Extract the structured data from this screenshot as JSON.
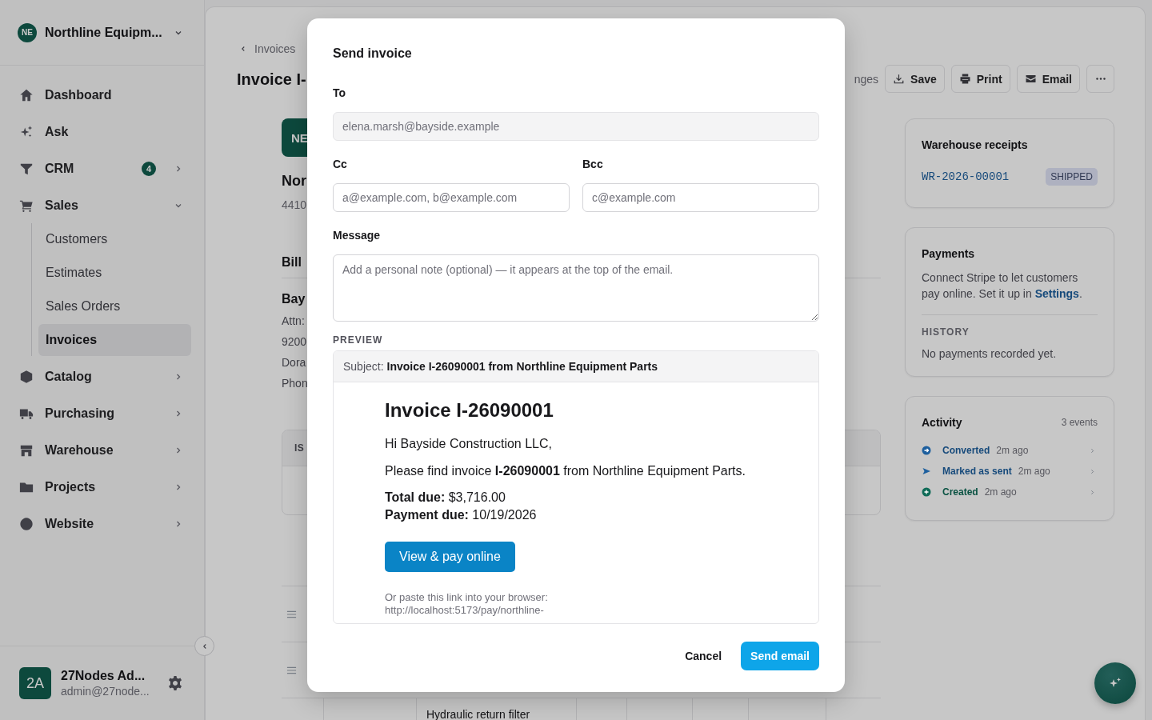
{
  "sidebar": {
    "workspace": {
      "initials": "NE",
      "name": "Northline Equipm..."
    },
    "items": [
      {
        "label": "Dashboard",
        "selected": false
      },
      {
        "label": "Ask",
        "selected": false
      },
      {
        "label": "CRM",
        "selected": false,
        "badge": "4",
        "expanded": false
      },
      {
        "label": "Sales",
        "selected": false,
        "expanded": true,
        "children": [
          {
            "label": "Customers",
            "selected": false
          },
          {
            "label": "Estimates",
            "selected": false
          },
          {
            "label": "Sales Orders",
            "selected": false
          },
          {
            "label": "Invoices",
            "selected": true
          }
        ]
      },
      {
        "label": "Catalog",
        "selected": false,
        "expanded": false
      },
      {
        "label": "Purchasing",
        "selected": false,
        "expanded": false
      },
      {
        "label": "Warehouse",
        "selected": false,
        "expanded": false
      },
      {
        "label": "Projects",
        "selected": false,
        "expanded": false
      },
      {
        "label": "Website",
        "selected": false,
        "expanded": false
      }
    ],
    "user": {
      "initials": "2A",
      "name": "27Nodes Ad...",
      "email": "admin@27node..."
    }
  },
  "page": {
    "breadcrumb": "Invoices",
    "title": "Invoice I-",
    "status_text": "nges",
    "buttons": [
      "Save",
      "Print",
      "Email"
    ]
  },
  "document": {
    "logo": "NE",
    "company": "Nor",
    "address": "4410",
    "bill_to": "Bill",
    "customer": "Bay",
    "lines": [
      "Attn:",
      "9200",
      "Dora",
      "Phon"
    ],
    "table_header": "IS",
    "item": "Hydraulic return filter"
  },
  "warehouse_receipts": {
    "title": "Warehouse receipts",
    "receipt": "WR-2026-00001",
    "status": "SHIPPED"
  },
  "payments": {
    "title": "Payments",
    "text": "Connect Stripe to let customers pay online. Set it up in ",
    "link": "Settings",
    "text_end": ".",
    "history_label": "HISTORY",
    "history_text": "No payments recorded yet."
  },
  "activity": {
    "title": "Activity",
    "count": "3 events",
    "events": [
      {
        "label": "Converted",
        "time": "2m ago",
        "color": "#1d5f9e"
      },
      {
        "label": "Marked as sent",
        "time": "2m ago",
        "color": "#1d5f9e"
      },
      {
        "label": "Created",
        "time": "2m ago",
        "color": "#0f6b57"
      }
    ]
  },
  "modal": {
    "title": "Send invoice",
    "to": {
      "label": "To",
      "value": "elena.marsh@bayside.example",
      "disabled": true
    },
    "cc": {
      "label": "Cc",
      "placeholder": "a@example.com, b@example.com"
    },
    "bcc": {
      "label": "Bcc",
      "placeholder": "c@example.com"
    },
    "message": {
      "label": "Message",
      "placeholder": "Add a personal note (optional) — it appears at the top of the email."
    },
    "preview": {
      "label": "PREVIEW",
      "subject_label": "Subject:",
      "subject": "Invoice I-26090001 from Northline Equipment Parts",
      "heading": "Invoice I-26090001",
      "greeting": "Hi Bayside Construction LLC,",
      "body": "Please find invoice **I-26090001** from Northline Equipment Parts.",
      "total": "**Total due:** $3,716.00",
      "due": "**Payment due:** 10/19/2026",
      "button": "View & pay online",
      "link_hint": "Or paste this link into your browser:",
      "link": "http://localhost:5173/pay/northline-"
    },
    "cancel": "Cancel",
    "send": "Send email"
  }
}
